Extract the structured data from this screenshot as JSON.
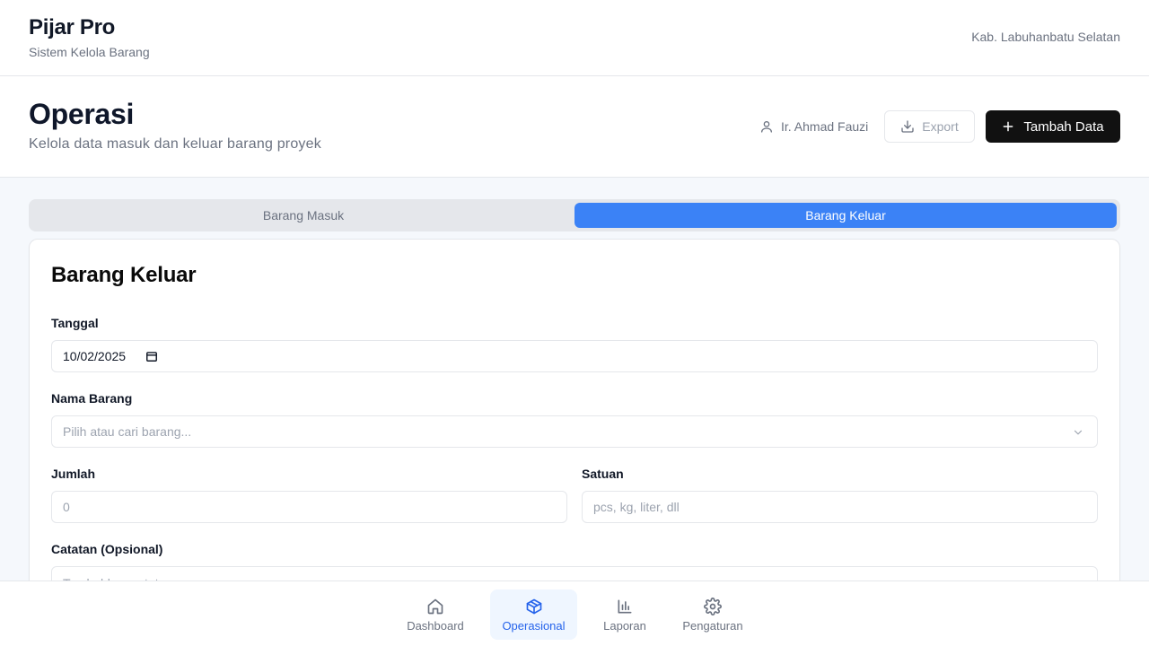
{
  "app": {
    "title": "Pijar Pro",
    "subtitle": "Sistem Kelola Barang",
    "region": "Kab. Labuhanbatu Selatan"
  },
  "page": {
    "title": "Operasi",
    "description": "Kelola data masuk dan keluar barang proyek",
    "user_name": "Ir. Ahmad Fauzi",
    "export_label": "Export",
    "add_label": "Tambah Data"
  },
  "tabs": [
    {
      "label": "Barang Masuk",
      "active": false
    },
    {
      "label": "Barang Keluar",
      "active": true
    }
  ],
  "form": {
    "title": "Barang Keluar",
    "tanggal": {
      "label": "Tanggal",
      "value": "10/02/2025"
    },
    "nama_barang": {
      "label": "Nama Barang",
      "placeholder": "Pilih atau cari barang..."
    },
    "jumlah": {
      "label": "Jumlah",
      "placeholder": "0"
    },
    "satuan": {
      "label": "Satuan",
      "placeholder": "pcs, kg, liter, dll"
    },
    "catatan": {
      "label": "Catatan (Opsional)",
      "placeholder": "Tambahkan catatan..."
    }
  },
  "bottom_nav": [
    {
      "label": "Dashboard",
      "icon": "home-icon",
      "active": false
    },
    {
      "label": "Operasional",
      "icon": "package-icon",
      "active": true
    },
    {
      "label": "Laporan",
      "icon": "bar-chart-icon",
      "active": false
    },
    {
      "label": "Pengaturan",
      "icon": "gear-icon",
      "active": false
    }
  ],
  "colors": {
    "accent": "#3b82f6",
    "primary_button": "#111111",
    "nav_active_bg": "#eff6ff",
    "nav_active_text": "#2563eb"
  }
}
